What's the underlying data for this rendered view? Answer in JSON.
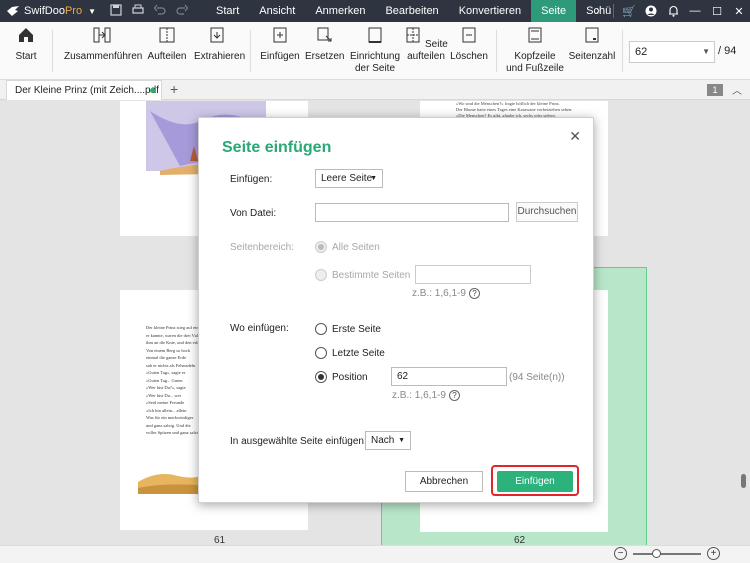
{
  "app": {
    "name": "SwifDoo",
    "edition": "Pro"
  },
  "menu": [
    "Start",
    "Ansicht",
    "Anmerken",
    "Bearbeiten",
    "Konvertieren",
    "Seite",
    "Schü"
  ],
  "active_menu": "Seite",
  "ribbon": {
    "start": "Start",
    "merge": "Zusammenführen",
    "split": "Aufteilen",
    "extract": "Extrahieren",
    "insert": "Einfügen",
    "replace": "Ersetzen",
    "orient_1": "Einrichtung",
    "orient_2": "der Seite",
    "split_page_1": "Seite",
    "split_page_2": "aufteilen",
    "delete": "Löschen",
    "header_1": "Kopfzeile",
    "header_2": "und Fußzeile",
    "page_number": "Seitenzahl",
    "current_page": "62",
    "total_pages": "/ 94"
  },
  "tabs": {
    "doc_title": "Der Kleine Prinz (mit Zeich....pdf",
    "page_badge": "1"
  },
  "document": {
    "page_labels": [
      "61",
      "62"
    ],
    "text_top_right": [
      "«Wo sind die Menschen?» fragte höflich der kleine Prinz.",
      "Der Blume hatte eines Tages eine Karawane vorbeiziehen sehen:",
      "«Die Menschen? Es gibt, glaube ich, sechs oder sieben."
    ],
    "text_left_page": [
      "Der kleine Prinz stieg auf einen",
      "er kannte, waren die drei Vulkane",
      "ihm an die Knie, und den erloschenen",
      "Von einem Berg so hoch",
      "einmal die ganze Erde",
      "sah er nichts als Felsnadeln",
      "«Guten Tag», sagte er",
      "«Guten Tag... Guten",
      "«Wer bist Du?», sagte",
      "«Wer bist Du... wer",
      "«Seid meine Freunde",
      "«Ich bin allein... allein",
      "Was für ein merkwürdiger",
      "und ganz salzig. Und die",
      "voller Spitzen und ganz salzig"
    ]
  },
  "zoom": {
    "level_fraction": 0.33
  },
  "dialog": {
    "title": "Seite einfügen",
    "insert_label": "Einfügen:",
    "insert_value": "Leere Seite",
    "from_file_label": "Von Datei:",
    "from_file_value": "",
    "browse": "Durchsuchen",
    "range_label": "Seitenbereich:",
    "range_all": "Alle Seiten",
    "range_specific": "Bestimmte Seiten",
    "range_specific_value": "",
    "range_hint": "z.B.: 1,6,1-9",
    "where_label": "Wo einfügen:",
    "first_page": "Erste Seite",
    "last_page": "Letzte Seite",
    "position": "Position",
    "position_value": "62",
    "position_suffix": "(94 Seite(n))",
    "position_hint": "z.B.: 1,6,1-9",
    "selected_label": "In ausgewählte Seite einfügen:",
    "selected_value": "Nach",
    "cancel": "Abbrechen",
    "confirm": "Einfügen"
  },
  "colors": {
    "accent": "#2aa877",
    "highlight": "#e0262b",
    "titlebar": "#2e3440",
    "selected_page": "#b8e6c9"
  }
}
